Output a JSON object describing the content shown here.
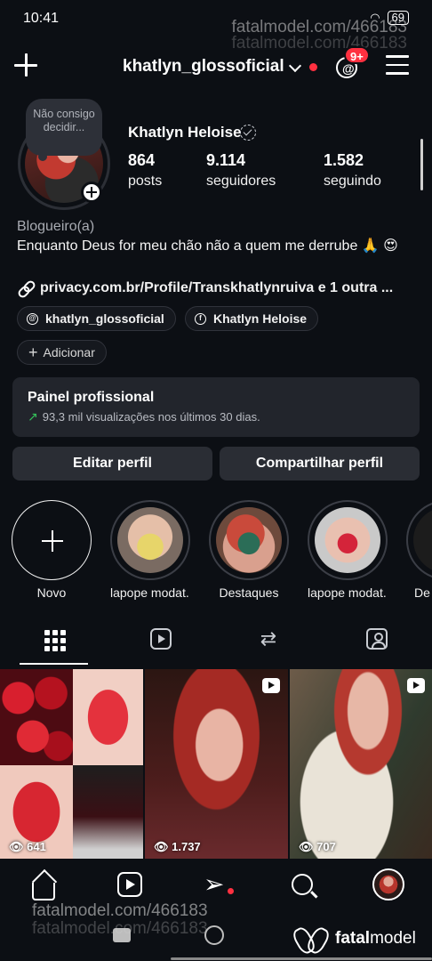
{
  "status": {
    "time": "10:41",
    "battery": "69"
  },
  "watermark": {
    "text": "fatalmodel.com/466183",
    "text_ghost": "fatalmodel.com/466183",
    "logo_prefix": "fatal",
    "logo_suffix": "model"
  },
  "header": {
    "username": "khatlyn_glossoficial",
    "threads_badge": "9+"
  },
  "profile": {
    "note": "Não consigo decidir...",
    "display_name": "Khatlyn Heloise",
    "stats": [
      {
        "value": "864",
        "label": "posts"
      },
      {
        "value": "9.114",
        "label": "seguidores"
      },
      {
        "value": "1.582",
        "label": "seguindo"
      }
    ],
    "category": "Blogueiro(a)",
    "bio": "Enquanto Deus for meu chão não a quem me derrube 🙏 😍",
    "link": "privacy.com.br/Profile/Transkhatlynruiva e 1 outra ...",
    "chips": [
      {
        "label": "khatlyn_glossoficial",
        "icon": "threads-icon"
      },
      {
        "label": "Khatlyn Heloise",
        "icon": "facebook-icon"
      }
    ],
    "add_label": "Adicionar"
  },
  "dashboard": {
    "title": "Painel profissional",
    "subtitle": "93,3 mil visualizações nos últimos 30 dias.",
    "trend_color": "#35c15a"
  },
  "actions": {
    "edit": "Editar perfil",
    "share": "Compartilhar perfil"
  },
  "highlights": [
    {
      "label": "Novo"
    },
    {
      "label": "lapope modat..."
    },
    {
      "label": "Destaques"
    },
    {
      "label": "lapope modat..."
    },
    {
      "label": "De"
    }
  ],
  "tabs": [
    "grid-icon",
    "reels-icon",
    "repost-icon",
    "tagged-icon"
  ],
  "posts": [
    {
      "views": "641",
      "type": "photo"
    },
    {
      "views": "1.737",
      "type": "reel"
    },
    {
      "views": "707",
      "type": "reel"
    }
  ],
  "colors": {
    "background": "#0c0f14",
    "card": "#22252c",
    "button": "#2a2d34",
    "notification": "#ff3040"
  }
}
